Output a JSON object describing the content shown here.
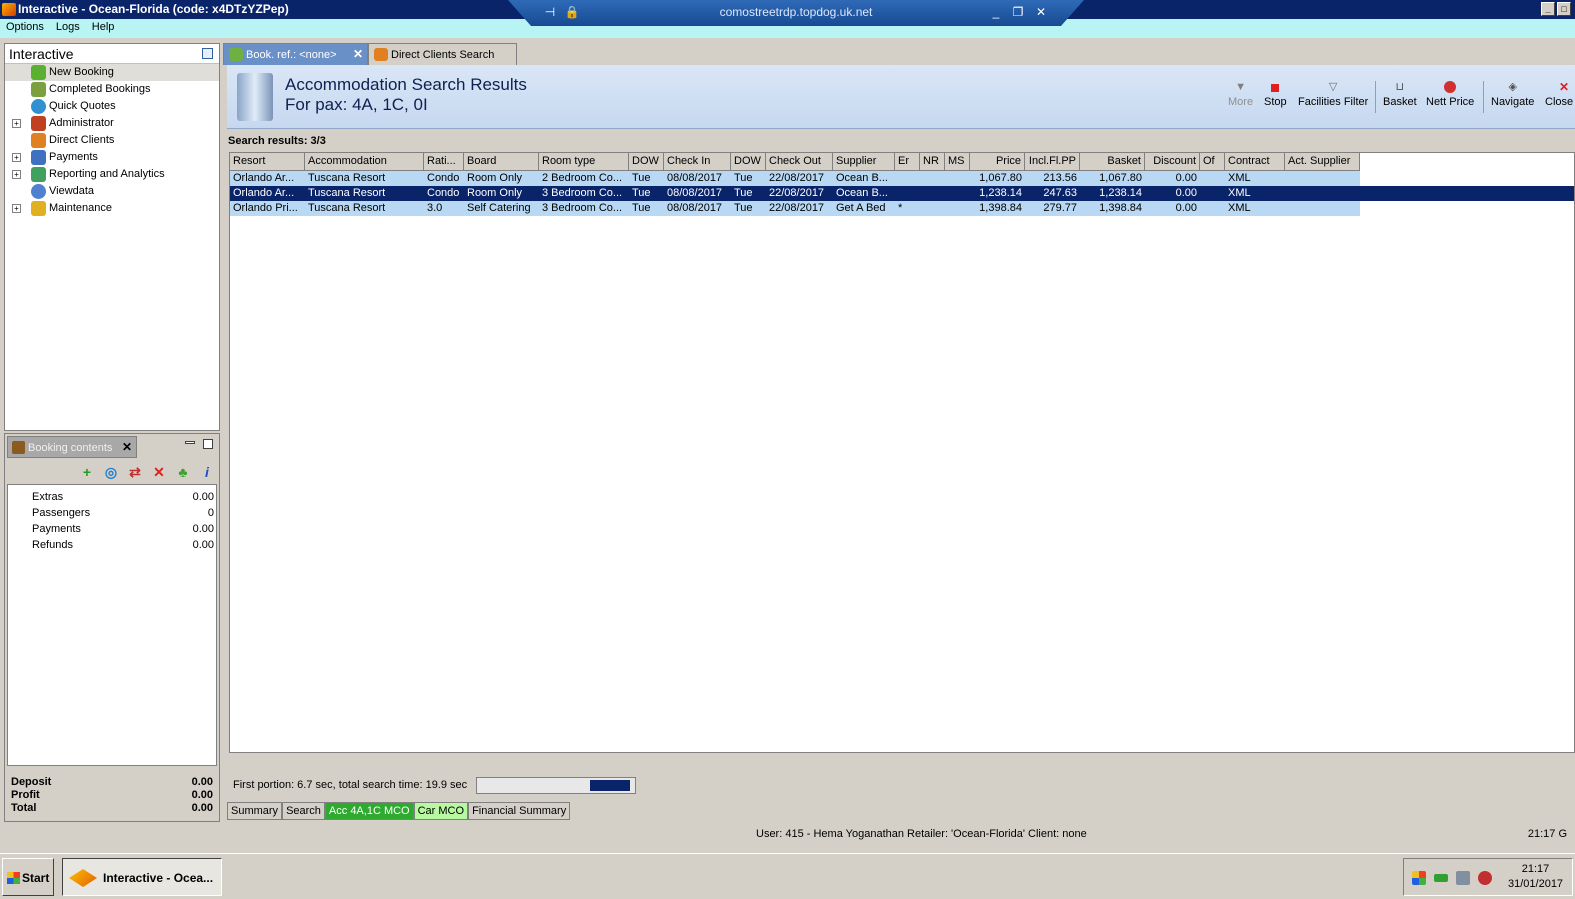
{
  "window": {
    "title": "Interactive - Ocean-Florida (code: x4DTzYZPep)"
  },
  "rdp": {
    "host": "comostreetrdp.topdog.uk.net"
  },
  "menu": {
    "items": [
      "Options",
      "Logs",
      "Help"
    ]
  },
  "nav": {
    "title": "Interactive",
    "items": [
      {
        "label": "New Booking"
      },
      {
        "label": "Completed Bookings"
      },
      {
        "label": "Quick Quotes"
      },
      {
        "label": "Administrator"
      },
      {
        "label": "Direct Clients"
      },
      {
        "label": "Payments"
      },
      {
        "label": "Reporting and Analytics"
      },
      {
        "label": "Viewdata"
      },
      {
        "label": "Maintenance"
      }
    ]
  },
  "booking": {
    "tab_label": "Booking contents",
    "rows": [
      {
        "label": "Extras",
        "value": "0.00"
      },
      {
        "label": "Passengers",
        "value": "0"
      },
      {
        "label": "Payments",
        "value": "0.00"
      },
      {
        "label": "Refunds",
        "value": "0.00"
      }
    ],
    "totals": [
      {
        "label": "Deposit",
        "value": "0.00"
      },
      {
        "label": "Profit",
        "value": "0.00"
      },
      {
        "label": "Total",
        "value": "0.00"
      }
    ]
  },
  "tabs": [
    {
      "label": "Book. ref.: <none>"
    },
    {
      "label": "Direct Clients Search"
    }
  ],
  "header": {
    "title": "Accommodation Search Results",
    "subtitle": "For pax: 4A, 1C, 0I"
  },
  "toolbar": {
    "more": "More",
    "stop": "Stop",
    "facilities": "Facilities Filter",
    "basket": "Basket",
    "nett": "Nett Price",
    "navigate": "Navigate",
    "close": "Close"
  },
  "results_label": "Search results: 3/3",
  "grid": {
    "columns": [
      "Resort",
      "Accommodation",
      "Rati...",
      "Board",
      "Room type",
      "DOW",
      "Check In",
      "DOW",
      "Check Out",
      "Supplier",
      "Er",
      "NR",
      "MS",
      "Price",
      "Incl.Fl.PP",
      "Basket",
      "Discount",
      "Of",
      "Contract",
      "Act. Supplier"
    ],
    "rows": [
      [
        "Orlando Ar...",
        "Tuscana Resort",
        "Condo",
        "Room Only",
        "2 Bedroom Co...",
        "Tue",
        "08/08/2017",
        "Tue",
        "22/08/2017",
        "Ocean B...",
        "",
        "",
        "",
        "1,067.80",
        "213.56",
        "1,067.80",
        "0.00",
        "",
        "XML",
        ""
      ],
      [
        "Orlando Ar...",
        "Tuscana Resort",
        "Condo",
        "Room Only",
        "3 Bedroom Co...",
        "Tue",
        "08/08/2017",
        "Tue",
        "22/08/2017",
        "Ocean B...",
        "",
        "",
        "",
        "1,238.14",
        "247.63",
        "1,238.14",
        "0.00",
        "",
        "XML",
        ""
      ],
      [
        "Orlando Pri...",
        "Tuscana Resort",
        "3.0",
        "Self Catering",
        "3 Bedroom Co...",
        "Tue",
        "08/08/2017",
        "Tue",
        "22/08/2017",
        "Get A Bed",
        "*",
        "",
        "",
        "1,398.84",
        "279.77",
        "1,398.84",
        "0.00",
        "",
        "XML",
        ""
      ]
    ]
  },
  "status": {
    "text": "First portion: 6.7 sec, total search time: 19.9 sec",
    "progress": 0.25
  },
  "bottom_tabs": [
    {
      "label": "Summary"
    },
    {
      "label": "Search"
    },
    {
      "label": "Acc 4A,1C MCO"
    },
    {
      "label": "Car MCO"
    },
    {
      "label": "Financial Summary"
    }
  ],
  "infobar": {
    "text": "User: 415 - Hema Yoganathan   Retailer: 'Ocean-Florida'   Client: none",
    "time": "21:17 G"
  },
  "taskbar": {
    "start": "Start",
    "app": "Interactive - Ocea...",
    "clock_time": "21:17",
    "clock_date": "31/01/2017"
  },
  "colors": {
    "titlebar": "#0a246a",
    "selected_row": "#0a246a",
    "row_highlight": "#b8d8f4",
    "accent_cyan": "#b8f4f4"
  }
}
